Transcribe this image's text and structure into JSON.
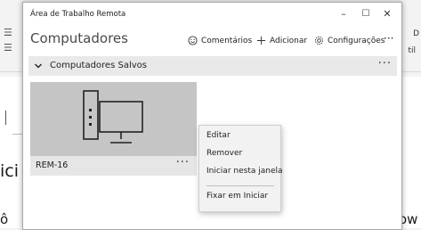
{
  "background": {
    "ribbon_icon_1": "☰",
    "ribbon_icon_2": "☰",
    "ribbon_right_1": "D",
    "ribbon_right_2": "til",
    "text_1": "ici",
    "text_2": "ô",
    "text_3": "ow"
  },
  "window": {
    "title": "Área de Trabalho Remota",
    "minimize_glyph": "–",
    "maximize_glyph": "☐",
    "close_glyph": "✕"
  },
  "toolbar": {
    "page_title": "Computadores",
    "feedback_label": "Comentários",
    "add_label": "Adicionar",
    "settings_label": "Configurações",
    "more_glyph": "···"
  },
  "group": {
    "label": "Computadores Salvos",
    "more_glyph": "···"
  },
  "tile": {
    "name": "REM-16",
    "more_glyph": "···"
  },
  "context_menu": {
    "items": [
      "Editar",
      "Remover",
      "Iniciar nesta janela",
      "Fixar em Iniciar"
    ]
  }
}
